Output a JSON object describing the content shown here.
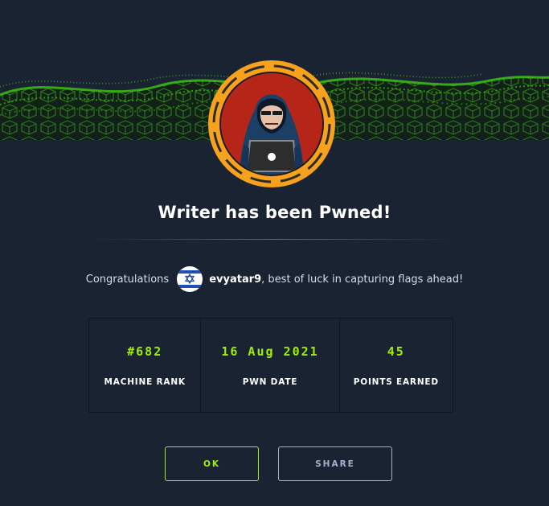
{
  "modal": {
    "title": "Writer has been Pwned!",
    "congrats_prefix": "Congratulations",
    "username": "evyatar9",
    "congrats_suffix": ", best of luck in capturing flags ahead!",
    "flag_icon": "israel-flag-icon",
    "avatar_icon": "hooded-hacker-avatar-icon"
  },
  "stats": [
    {
      "value": "#682",
      "label": "MACHINE RANK"
    },
    {
      "value": "16 Aug 2021",
      "label": "PWN DATE"
    },
    {
      "value": "45",
      "label": "POINTS EARNED"
    }
  ],
  "buttons": {
    "ok_label": "OK",
    "share_label": "SHARE"
  },
  "colors": {
    "background": "#1a2332",
    "accent": "#9fef00",
    "avatar_ring": "#f7a21c",
    "secondary_button": "#a4b1cd"
  }
}
